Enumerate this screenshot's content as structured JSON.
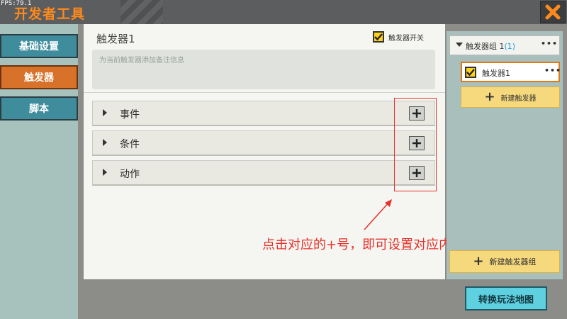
{
  "app": {
    "fps": "FPS:79.1",
    "title": "开发者工具"
  },
  "sidebar": {
    "items": [
      {
        "label": "基础设置"
      },
      {
        "label": "触发器",
        "active": true
      },
      {
        "label": "脚本"
      }
    ]
  },
  "main": {
    "trigger_name": "触发器1",
    "switch_label": "触发器开关",
    "switch_checked": true,
    "note_placeholder": "为当前触发器添加备注信息",
    "rows": [
      {
        "label": "事件"
      },
      {
        "label": "条件"
      },
      {
        "label": "动作"
      }
    ]
  },
  "annotation": {
    "text": "点击对应的+号，即可设置对应内容",
    "color": "#e8312a"
  },
  "right_panel": {
    "group": {
      "name": "触发器组 1",
      "count": "(1)"
    },
    "trigger_item": {
      "name": "触发器1",
      "checked": true
    },
    "new_trigger_label": "新建触发器",
    "new_group_label": "新建触发器组"
  },
  "footer": {
    "map_button_label": "转换玩法地图"
  },
  "colors": {
    "accent_orange": "#ff8a1c",
    "active_tab": "#d8712a",
    "tab": "#3f8c9c",
    "checkbox": "#ffd21c",
    "button_yellow": "#f6d97c",
    "cyan_button": "#5fd0e0"
  },
  "icons": {
    "close": "close-icon",
    "plus": "plus-icon",
    "caret": "caret-right-icon",
    "more": "more-dots-icon"
  }
}
